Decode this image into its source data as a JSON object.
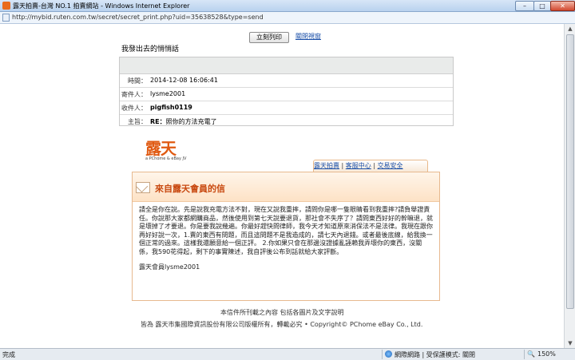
{
  "window": {
    "title": "露天拍賣-台灣 NO.1 拍賣網站 - Windows Internet Explorer",
    "minimize_label": "–",
    "maximize_label": "□",
    "close_label": "✕",
    "url": "http://mybid.ruten.com.tw/secret/secret_print.php?uid=35638528&type=send"
  },
  "toolbar": {
    "print_label": "立刻列印",
    "close_label": "關閉視窗"
  },
  "section_title": "我發出去的悄悄話",
  "message": {
    "time_label": "時間：",
    "time_value": "2014-12-08 16:06:41",
    "sender_label": "寄件人：",
    "sender_value": "lysme2001",
    "recipient_label": "收件人：",
    "recipient_value": "pigfish0119",
    "subject_label": "主旨：",
    "subject_prefix": "RE：",
    "subject_value": "照你的方法充電了"
  },
  "logo": {
    "mark": "露天",
    "sub": "a PChome & eBay JV"
  },
  "tabs": {
    "item1": "露天拍賣",
    "sep1": " | ",
    "item2": "客服中心",
    "sep2": " | ",
    "item3": "交易安全"
  },
  "letter": {
    "title": "來自露天會員的信",
    "para1": "請全是你在說。先是說我充電方法不對，現在又說我重摔，請問你是哪一隻眼睛看到我重摔?請負舉證責任。你說那大家都網購商品，然後使用到第七天說要退貨，那社會不失序了？請問東西好好的幹嘛退，就是壞掉了才要退。你是要我說幾遍。你最好趕快問律師，我今天才知道原來消保法不是法律。我現在跟你再好好說一次，1.賣的東西有問題，而且這問題不是我造成的，請七天內退錢。或者最後底線，給我換一個正常的過來。這樣我還願意給一個正評。 2.你如果只會在那邊沒證據亂誣賴我弄壞你的東西，沒關係，我590花得起，剩下的事實陳述，我自評後公布到話就給大家評斷。",
    "signature": "露天會員lysme2001"
  },
  "footer": {
    "line1": "本信件所刊載之內容 包括各圖片及文字說明",
    "line2": "皆為 露天市集國際資訊股份有限公司版權所有，轉載必究 • Copyright©    PChome eBay Co., Ltd."
  },
  "statusbar": {
    "status": "完成",
    "zone": "網際網路 | 受保護模式: 關閉",
    "zoom": "150%"
  }
}
